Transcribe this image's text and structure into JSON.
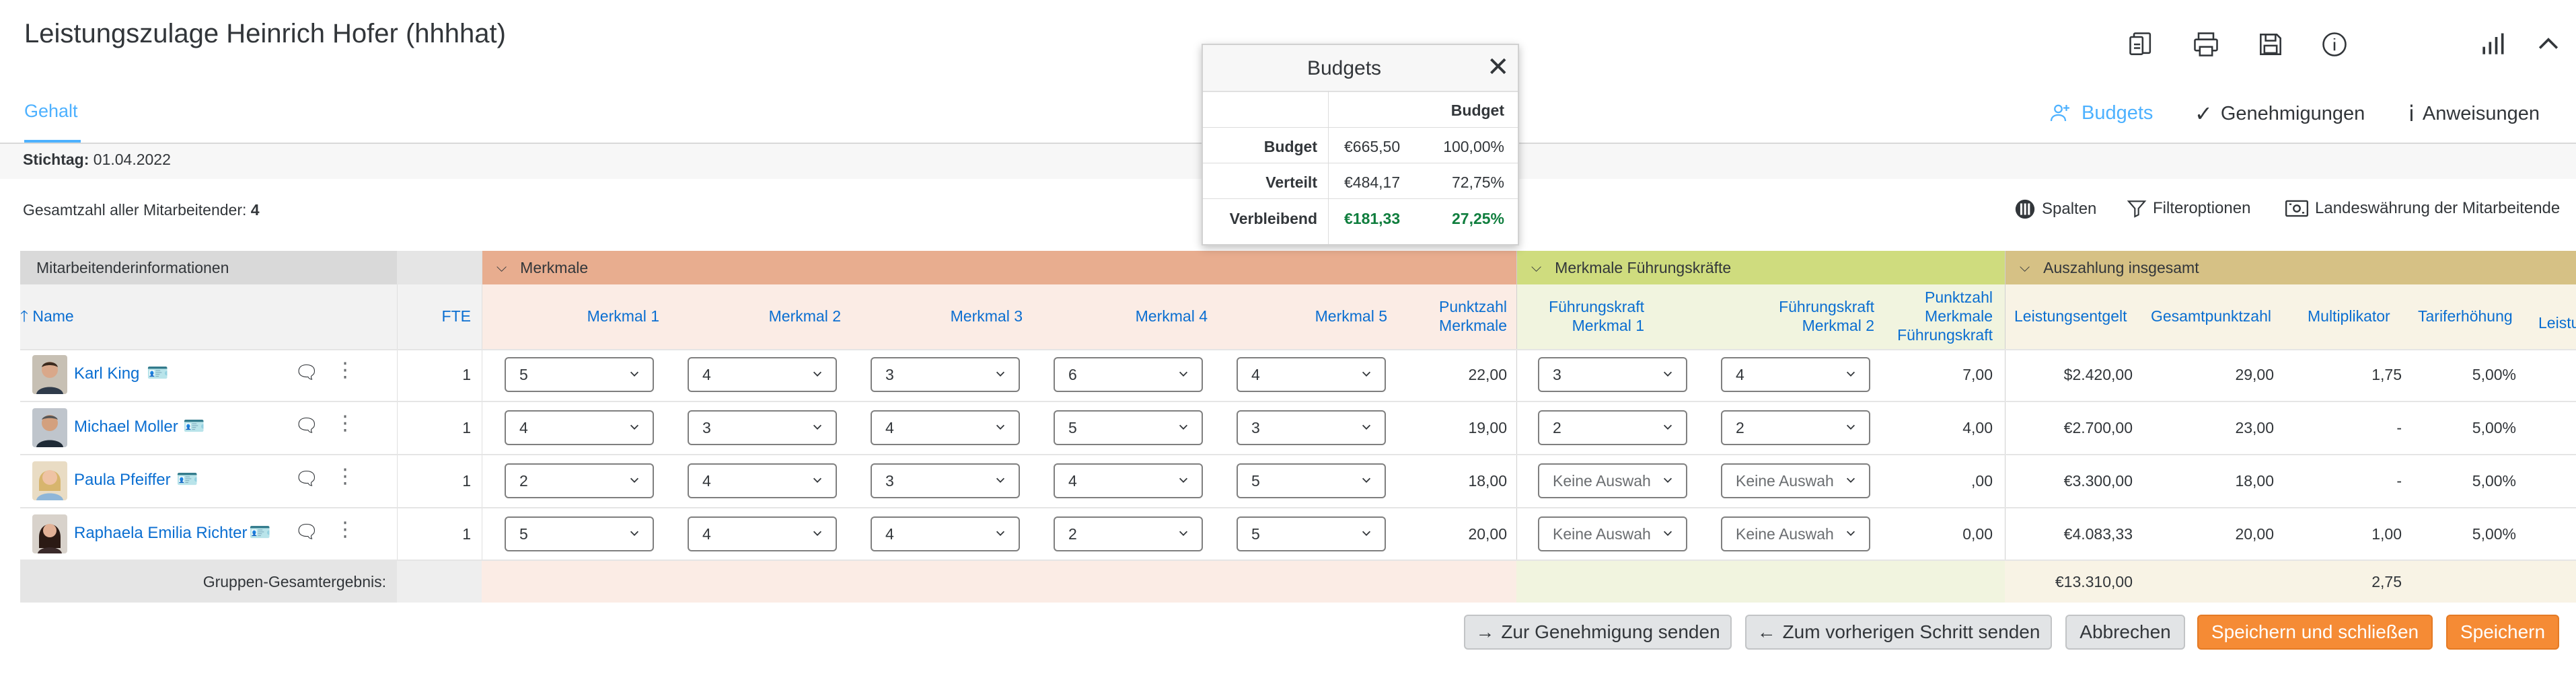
{
  "page": {
    "title": "Leistungszulage Heinrich Hofer (hhhhat)",
    "tab": "Gehalt",
    "stichtag_label": "Stichtag:",
    "stichtag_value": "01.04.2022",
    "total_label": "Gesamtzahl aller Mitarbeitender:",
    "total_value": "4"
  },
  "top_icons": [
    "export-icon",
    "print-icon",
    "save-icon",
    "info-icon",
    "bar-chart-icon",
    "collapse-icon"
  ],
  "right_actions": {
    "budgets": "Budgets",
    "genehmigungen": "Genehmigungen",
    "anweisungen": "Anweisungen"
  },
  "toolbar": {
    "spalten": "Spalten",
    "filter": "Filteroptionen",
    "currency": "Landeswährung der Mitarbeitende"
  },
  "groups": {
    "info": "Mitarbeitenderinformationen",
    "merkmale": "Merkmale",
    "fk": "Merkmale Führungskräfte",
    "auszahlung": "Auszahlung insgesamt"
  },
  "columns": {
    "name": "Name",
    "fte": "FTE",
    "m1": "Merkmal 1",
    "m2": "Merkmal 2",
    "m3": "Merkmal 3",
    "m4": "Merkmal 4",
    "m5": "Merkmal 5",
    "pm1": "Punktzahl",
    "pm2": "Merkmale",
    "fk1a": "Führungskraft",
    "fk1b": "Merkmal 1",
    "fk2a": "Führungskraft",
    "fk2b": "Merkmal 2",
    "pf1": "Punktzahl",
    "pf2": "Merkmale",
    "pf3": "Führungskraft",
    "le": "Leistungsentgelt",
    "gp": "Gesamtpunktzahl",
    "mu": "Multiplikator",
    "te": "Tariferhöhung",
    "lz": "Leistu"
  },
  "rows": [
    {
      "name": "Karl King",
      "fte": "1",
      "m1": "5",
      "m2": "4",
      "m3": "3",
      "m4": "6",
      "m5": "4",
      "pm": "22,00",
      "fk1": "3",
      "fk2": "4",
      "pf": "7,00",
      "le": "$2.420,00",
      "gp": "29,00",
      "mu": "1,75",
      "te": "5,00%"
    },
    {
      "name": "Michael Moller",
      "fte": "1",
      "m1": "4",
      "m2": "3",
      "m3": "4",
      "m4": "5",
      "m5": "3",
      "pm": "19,00",
      "fk1": "2",
      "fk2": "2",
      "pf": "4,00",
      "le": "€2.700,00",
      "gp": "23,00",
      "mu": "-",
      "te": "5,00%"
    },
    {
      "name": "Paula Pfeiffer",
      "fte": "1",
      "m1": "2",
      "m2": "4",
      "m3": "3",
      "m4": "4",
      "m5": "5",
      "pm": "18,00",
      "fk1": "Keine Auswah",
      "fk2": "Keine Auswah",
      "pf": ",00",
      "le": "€3.300,00",
      "gp": "18,00",
      "mu": "-",
      "te": "5,00%"
    },
    {
      "name": "Raphaela Emilia Richter",
      "fte": "1",
      "m1": "5",
      "m2": "4",
      "m3": "4",
      "m4": "2",
      "m5": "5",
      "pm": "20,00",
      "fk1": "Keine Auswah",
      "fk2": "Keine Auswah",
      "pf": "0,00",
      "le": "€4.083,33",
      "gp": "20,00",
      "mu": "1,00",
      "te": "5,00%"
    }
  ],
  "group_total": {
    "label": "Gruppen-Gesamtergebnis:",
    "le": "€13.310,00",
    "mu": "2,75"
  },
  "budgets_popup": {
    "title": "Budgets",
    "col": "Budget",
    "rows": [
      {
        "label": "Budget",
        "amount": "€665,50",
        "pct": "100,00%"
      },
      {
        "label": "Verteilt",
        "amount": "€484,17",
        "pct": "72,75%"
      },
      {
        "label": "Verbleibend",
        "amount": "€181,33",
        "pct": "27,25%"
      }
    ]
  },
  "buttons": {
    "send_approval": "Zur Genehmigung senden",
    "send_previous": "Zum vorherigen Schritt senden",
    "cancel": "Abbrechen",
    "save_close": "Speichern und schließen",
    "save": "Speichern"
  },
  "colors": {
    "merkmale_header": "#e8ad8f",
    "merkmale_body": "#fbece5",
    "fk_header": "#cfdc7e",
    "fk_body": "#f1f4df",
    "ausz_header": "#d6c185",
    "ausz_body": "#f8f3e5",
    "info_header": "#d9d9d9",
    "link_blue": "#0a6ed1",
    "green": "#107e3e",
    "orange": "#f58b35"
  }
}
